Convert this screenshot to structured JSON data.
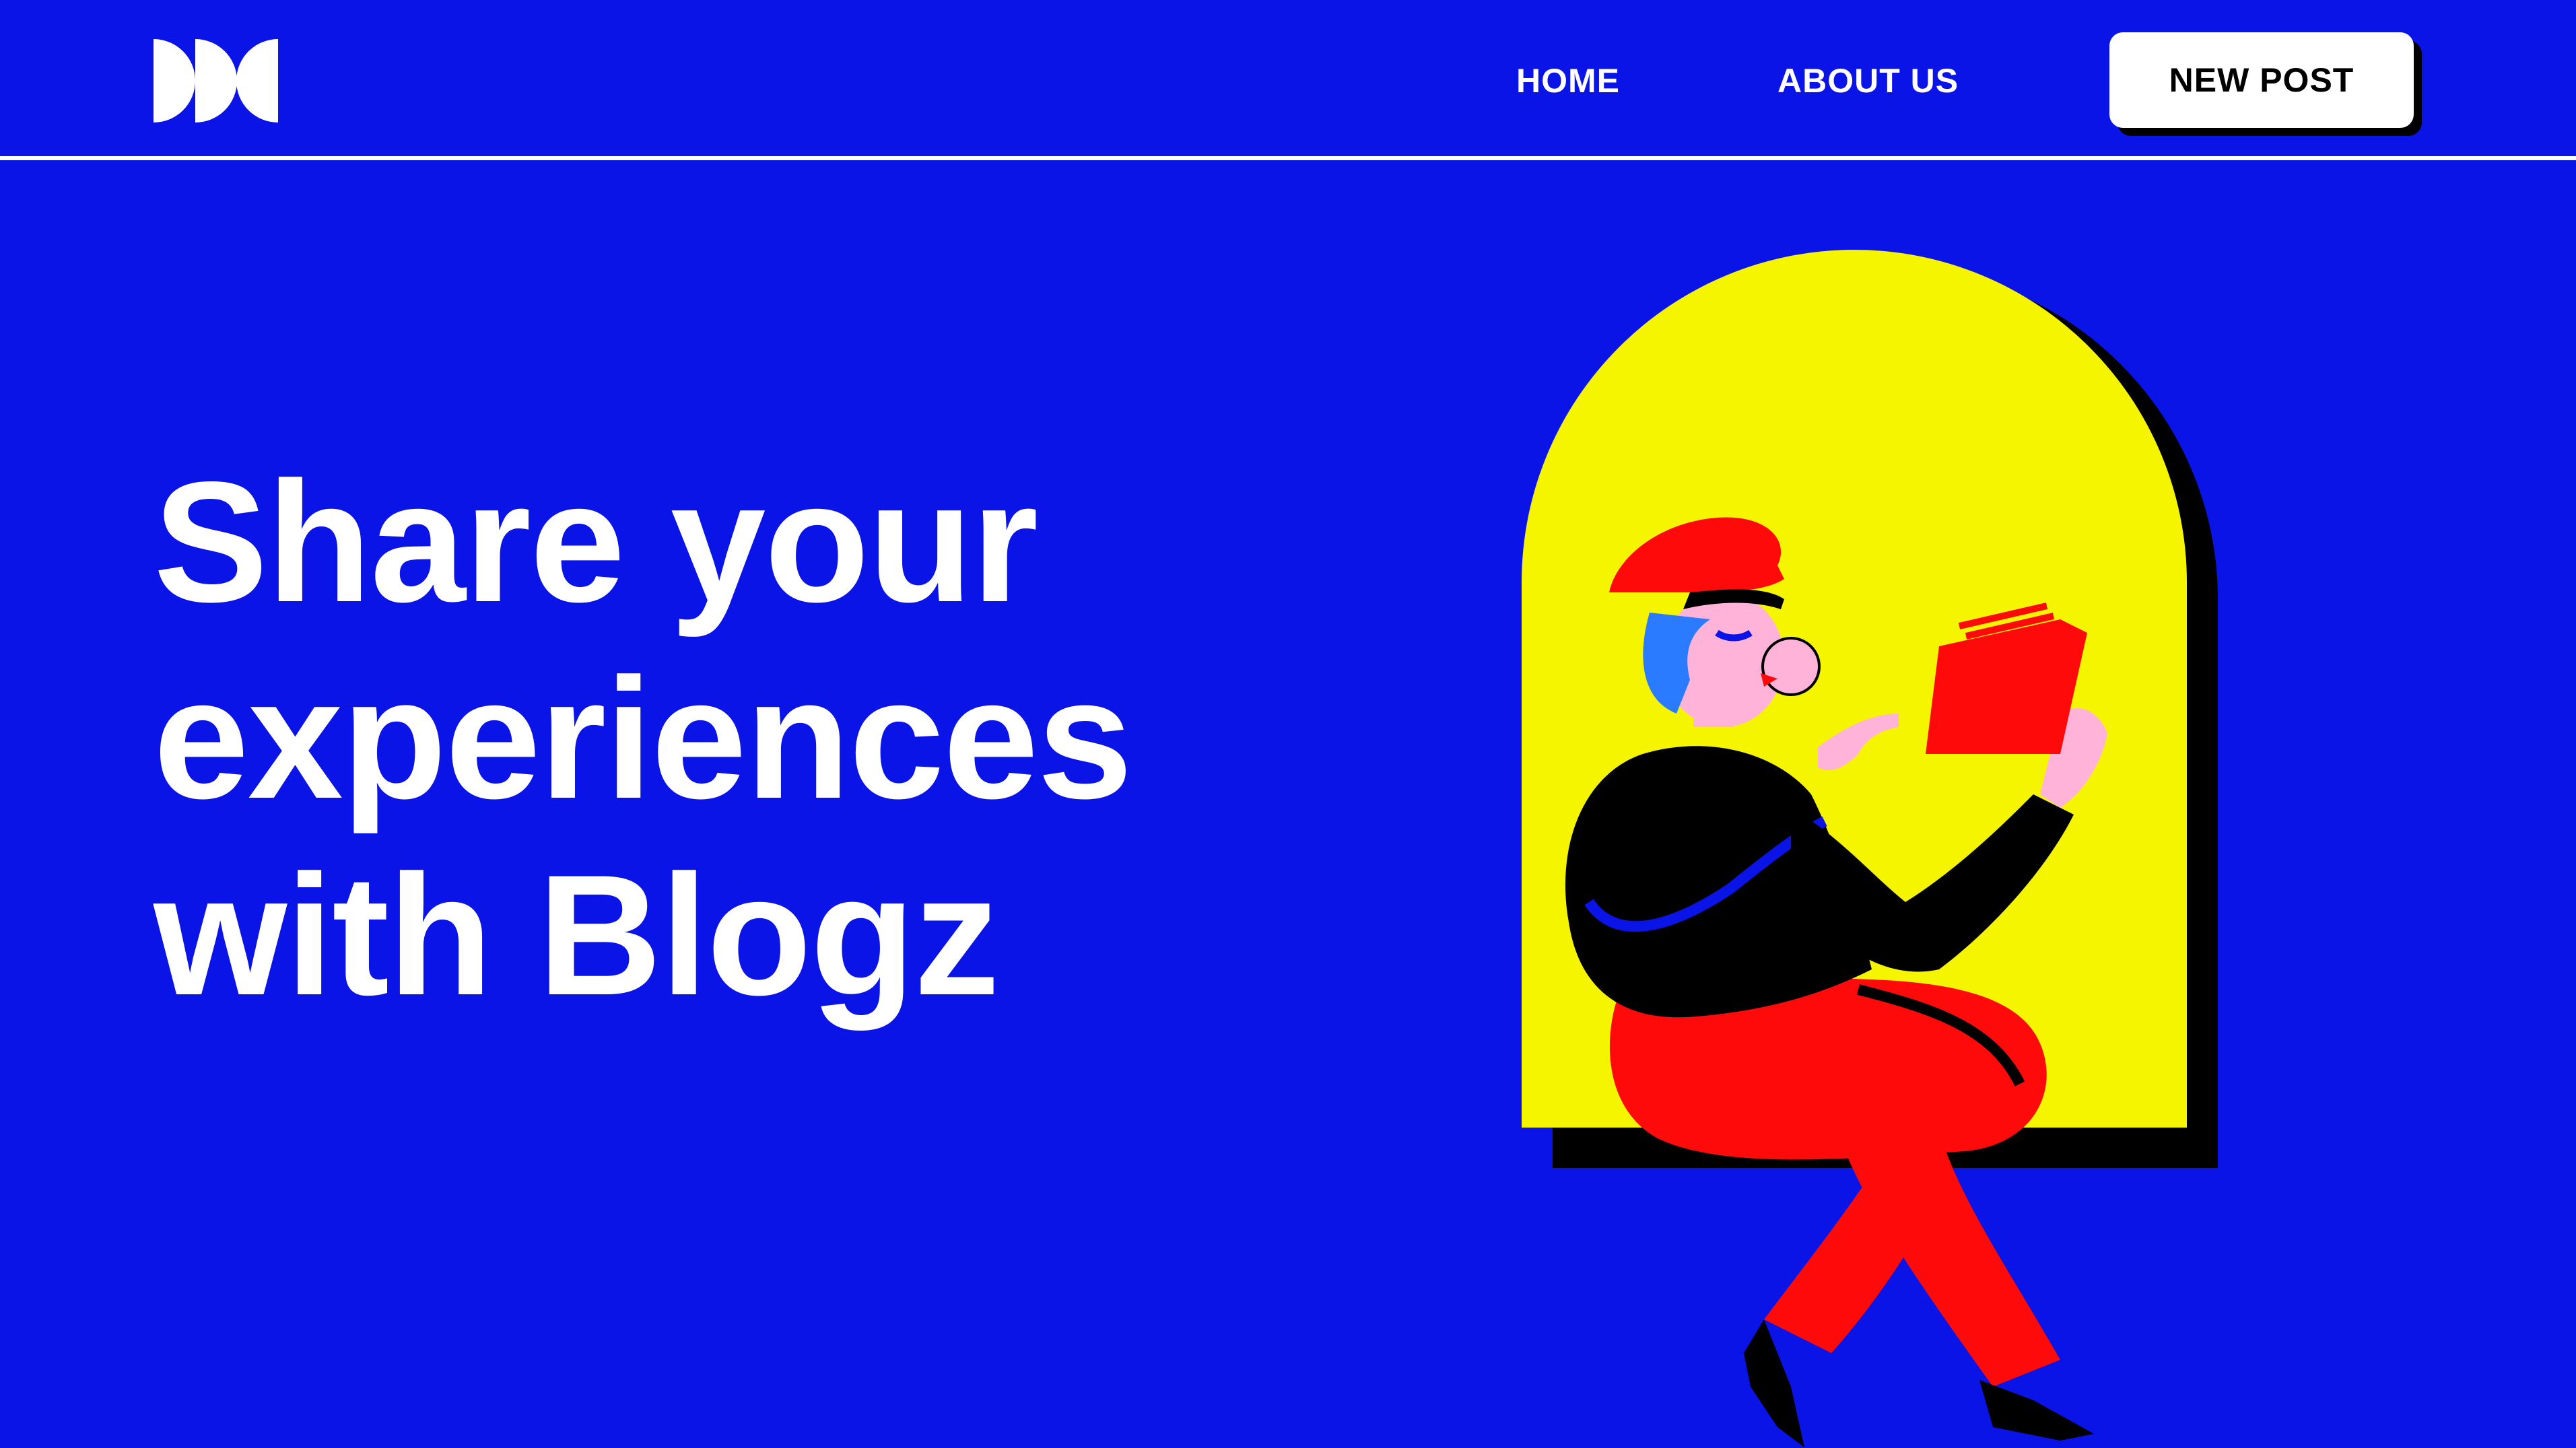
{
  "header": {
    "logo_name": "blogz-logo",
    "nav": {
      "home_label": "HOME",
      "about_label": "ABOUT US"
    },
    "new_post_label": "NEW POST"
  },
  "hero": {
    "title_lines": [
      "Share your",
      "experiences",
      "with Blogz"
    ]
  },
  "illustration": {
    "subject": "person-reading-book-icon"
  },
  "colors": {
    "background": "#0A14E6",
    "accent_yellow": "#F5F500",
    "accent_red": "#FF0A0A",
    "text": "#FFFFFF",
    "shadow": "#000000"
  }
}
